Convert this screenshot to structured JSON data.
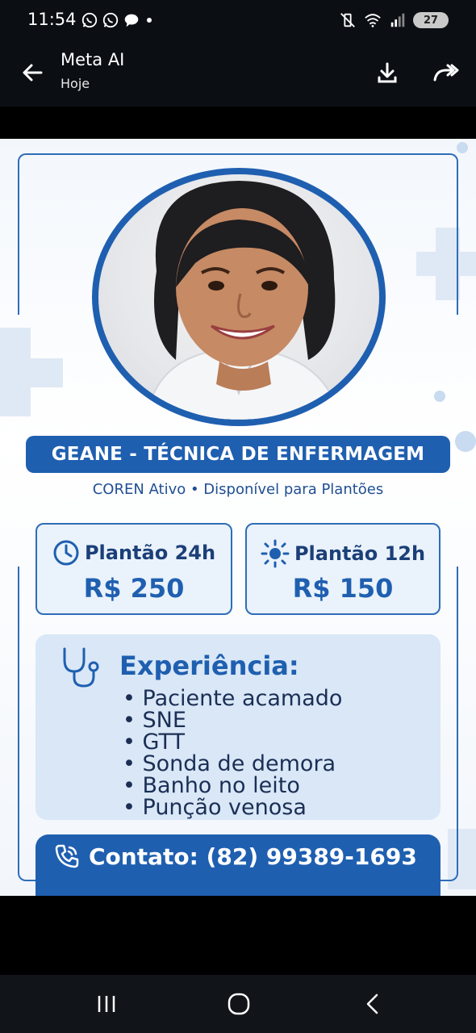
{
  "status_bar": {
    "time": "11:54",
    "battery": "27",
    "icons_left": [
      "whatsapp-icon",
      "whatsapp-icon",
      "chat-icon",
      "dot-icon"
    ],
    "icons_right": [
      "mute-vibrate-icon",
      "wifi-icon",
      "signal-icon",
      "battery-icon"
    ]
  },
  "app_bar": {
    "title": "Meta AI",
    "subtitle": "Hoje",
    "actions": [
      "download-icon",
      "share-icon"
    ]
  },
  "flyer": {
    "name_banner": "GEANE - TÉCNICA DE ENFERMAGEM",
    "subtitle": "COREN Ativo • Disponível para Plantões",
    "prices": [
      {
        "label": "Plantão 24h",
        "value": "R$ 250",
        "icon": "clock-icon"
      },
      {
        "label": "Plantão 12h",
        "value": "R$ 150",
        "icon": "sun-icon"
      }
    ],
    "experience_title": "Experiência:",
    "experience_items": [
      "Paciente acamado",
      "SNE",
      "GTT",
      "Sonda de demora",
      "Banho no leito",
      "Punção venosa"
    ],
    "contact": "Contato: (82) 99389-1693",
    "colors": {
      "primary": "#1f5fb0",
      "light": "#d9e7f7",
      "text_dark": "#1b2f55"
    }
  },
  "nav_bar": {
    "buttons": [
      "recents-icon",
      "home-icon",
      "back-icon"
    ]
  }
}
